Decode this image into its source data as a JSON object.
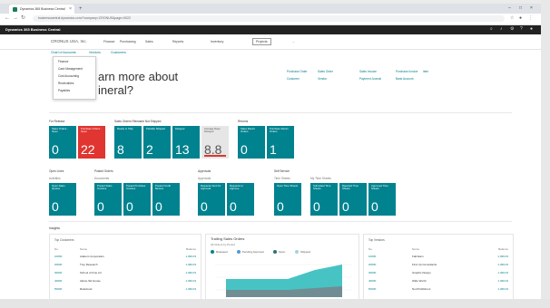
{
  "colors": {
    "teal": "#00828f",
    "red": "#e03530",
    "app_bar": "#222222"
  },
  "browser": {
    "tab_title": "Dynamics 365 Business Central",
    "address": "businesscentral.dynamics.com/?company=CRONUS&page=9022"
  },
  "app": {
    "title": "Dynamics 365 Business Central",
    "icons": [
      "search-icon",
      "bell-icon",
      "gear-icon",
      "help-icon",
      "user-icon"
    ]
  },
  "nav": {
    "company": "CRONUS USA, Inc.",
    "links": [
      "Finance",
      "Purchasing",
      "Sales",
      "Reports",
      "Inventory",
      "Projects"
    ],
    "sub": [
      "Chart of Accounts",
      "Vendors",
      "Customers"
    ]
  },
  "dropdown": {
    "items": [
      "Finance",
      "Cash Management",
      "Cost Accounting",
      "Receivables",
      "Payables"
    ]
  },
  "headline": {
    "line1": "arn more about",
    "line2": "ineral?"
  },
  "quick_links": [
    "Purchase Order",
    "Sales Order",
    "Sales Invoice",
    "Purchase Invoice",
    "Item",
    "Customer",
    "Vendor",
    "Payment Journal",
    "Bank Account"
  ],
  "groups": {
    "top": [
      {
        "label": "For Release",
        "tiles": [
          {
            "label": "Sales Orders - Open",
            "value": "0",
            "style": "teal"
          },
          {
            "label": "Purchase Orders - Open",
            "value": "22",
            "style": "red"
          }
        ]
      },
      {
        "label": "Sales Orders Released Not Shipped",
        "tiles": [
          {
            "label": "Ready to Ship",
            "value": "8",
            "style": "teal"
          },
          {
            "label": "Partially Shipped",
            "value": "2",
            "style": "teal"
          },
          {
            "label": "Delayed",
            "value": "13",
            "style": "teal"
          },
          {
            "label": "Average Days Delayed",
            "value": "8.8",
            "style": "gray"
          }
        ]
      },
      {
        "label": "Returns",
        "tiles": [
          {
            "label": "Sales Return Orders",
            "value": "0",
            "style": "teal"
          },
          {
            "label": "Purchase Return Orders",
            "value": "1",
            "style": "teal"
          }
        ]
      }
    ],
    "bottom": [
      {
        "label": "Open Lines",
        "sub": "Activities",
        "tiles": [
          {
            "label": "Open Sales Quotes",
            "value": "0",
            "style": "teal"
          }
        ]
      },
      {
        "label": "Posted Orders",
        "sub": "Documents",
        "tiles": [
          {
            "label": "Posted Sales Invoices",
            "value": "0",
            "style": "teal"
          },
          {
            "label": "Posted Purchase Invoices",
            "value": "0",
            "style": "teal"
          },
          {
            "label": "Posted Credit Memos",
            "value": "0",
            "style": "teal"
          }
        ]
      },
      {
        "label": "Approvals",
        "sub": "Approvals",
        "tiles": [
          {
            "label": "Requests Sent for Approval",
            "value": "0",
            "style": "teal"
          },
          {
            "label": "Requests to Approve",
            "value": "0",
            "style": "teal"
          }
        ]
      },
      {
        "label": "Self Service",
        "sub": "Time Sheets",
        "tiles": [
          {
            "label": "Open Time Sheets",
            "value": "0",
            "style": "teal"
          },
          {
            "label": "Submitted Time Sheets",
            "value": "0",
            "style": "teal"
          },
          {
            "label": "Rejected Time Sheets",
            "value": "0",
            "style": "teal"
          },
          {
            "label": "Approved Time Sheets",
            "value": "0",
            "style": "teal"
          }
        ]
      }
    ]
  },
  "insights": {
    "title": "Insights",
    "left": {
      "title": "Top Customers",
      "cols": [
        "No.",
        "Name",
        "Balance"
      ],
      "rows": [
        [
          "10000",
          "Adatum Corporation",
          "1,499.03"
        ],
        [
          "20000",
          "Trey Research",
          "1,499.03"
        ],
        [
          "30000",
          "School of Fine Art",
          "1,499.03"
        ],
        [
          "40000",
          "Alpine Ski House",
          "1,499.03"
        ],
        [
          "50000",
          "Relecloud",
          "1,499.03"
        ]
      ]
    },
    "chart": {
      "title": "Trailing Sales Orders",
      "subtitle": "All Orders by Period",
      "legend": [
        "Released",
        "Pending Approval",
        "Open",
        "Shipped"
      ]
    },
    "right": {
      "title": "Top Vendors",
      "cols": [
        "No.",
        "Name",
        "Balance"
      ],
      "rows": [
        [
          "10000",
          "Fabrikam",
          "1,499.03"
        ],
        [
          "20000",
          "First Up Consultants",
          "1,499.03"
        ],
        [
          "30000",
          "Graphic Design",
          "1,499.03"
        ],
        [
          "40000",
          "Wide World",
          "1,499.03"
        ],
        [
          "50000",
          "Nod Publishers",
          "1,499.03"
        ]
      ]
    }
  }
}
